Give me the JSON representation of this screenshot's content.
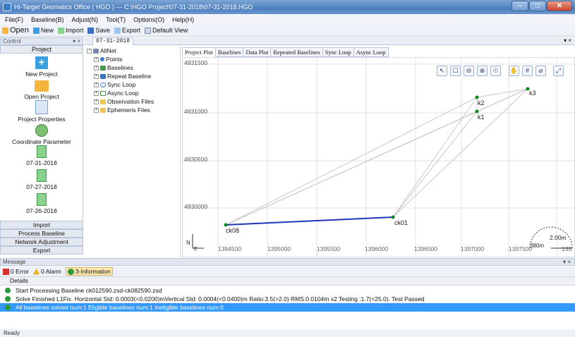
{
  "window": {
    "title": "Hi-Target Geomatics Office ( HGO ) — C:\\HGO Project\\07-31-2018\\07-31-2018.HGO",
    "min": "–",
    "max": "□",
    "close": "✕"
  },
  "menu": [
    "File(F)",
    "Baseline(B)",
    "Adjust(N)",
    "Tool(T)",
    "Options(O)",
    "Help(H)"
  ],
  "toolbar": {
    "open": "Open",
    "new": "New",
    "import": "Import",
    "save": "Save",
    "export": "Export",
    "default_view": "Default View"
  },
  "control": {
    "header": "Control",
    "pin": "▾ ×",
    "tab": "Project",
    "items": [
      "New Project",
      "Open Project",
      "Project Properties",
      "Coordinate Parameter",
      "07-31-2018",
      "07-27-2018",
      "07-26-2018"
    ],
    "buttons": [
      "Import",
      "Process Baseline",
      "Network Adjustment",
      "Export"
    ]
  },
  "tree": {
    "root": "AllNet",
    "children": [
      "Points",
      "Baselines",
      "Repeat Baseline",
      "Sync Loop",
      "Async Loop",
      "Observation Files",
      "Ephemeris Files"
    ]
  },
  "doc": {
    "tab": "07-31-2018",
    "arrow": "▾ ×"
  },
  "view_tabs": [
    "Project Plot",
    "Baselines",
    "Data Plot",
    "Repeated Baselines",
    "Sync Loop",
    "Async Loop"
  ],
  "plot": {
    "y_ticks": [
      "4931500",
      "4931000",
      "4930500",
      "4930000"
    ],
    "x_ticks": [
      "1394500",
      "1395000",
      "1395500",
      "1396000",
      "1396500",
      "1397000",
      "1397500",
      "139"
    ],
    "points": [
      {
        "name": "ck08"
      },
      {
        "name": "ck01"
      },
      {
        "name": "k1"
      },
      {
        "name": "k2"
      },
      {
        "name": "k3"
      }
    ],
    "scale_top": "2.00m",
    "scale_bottom": "380m",
    "north": "N",
    "east": "E",
    "tools": [
      "↖",
      "☐",
      "⊖",
      "⊕",
      "☉",
      "✋",
      "#",
      "⌀",
      "⤢"
    ],
    "colors": {
      "line": "#c9c9c9",
      "active": "#1f36b8",
      "point": "#0b8a1e"
    }
  },
  "message": {
    "header": "Message",
    "pin": "▾ ×",
    "filters": {
      "error": "0 Error",
      "alarm": "0 Alarm",
      "info": "3-Information"
    },
    "col": "Details",
    "rows": [
      "Start Processing Baseline  ck012590.zsd-ck082590.zsd",
      "Solve Finished  L1Fix. Horizontal Std: 0.0003(<0.0200)mVertical Std: 0.0004(<0.0400)m Ratio:3.5(>2.0) RMS:0.0104m x2 Testing :1.7(<25.0).  Test Passed",
      "All baselines solved num:1  Eligible baselines num:1  Ineligible baselines num:0"
    ]
  },
  "status": "Ready"
}
